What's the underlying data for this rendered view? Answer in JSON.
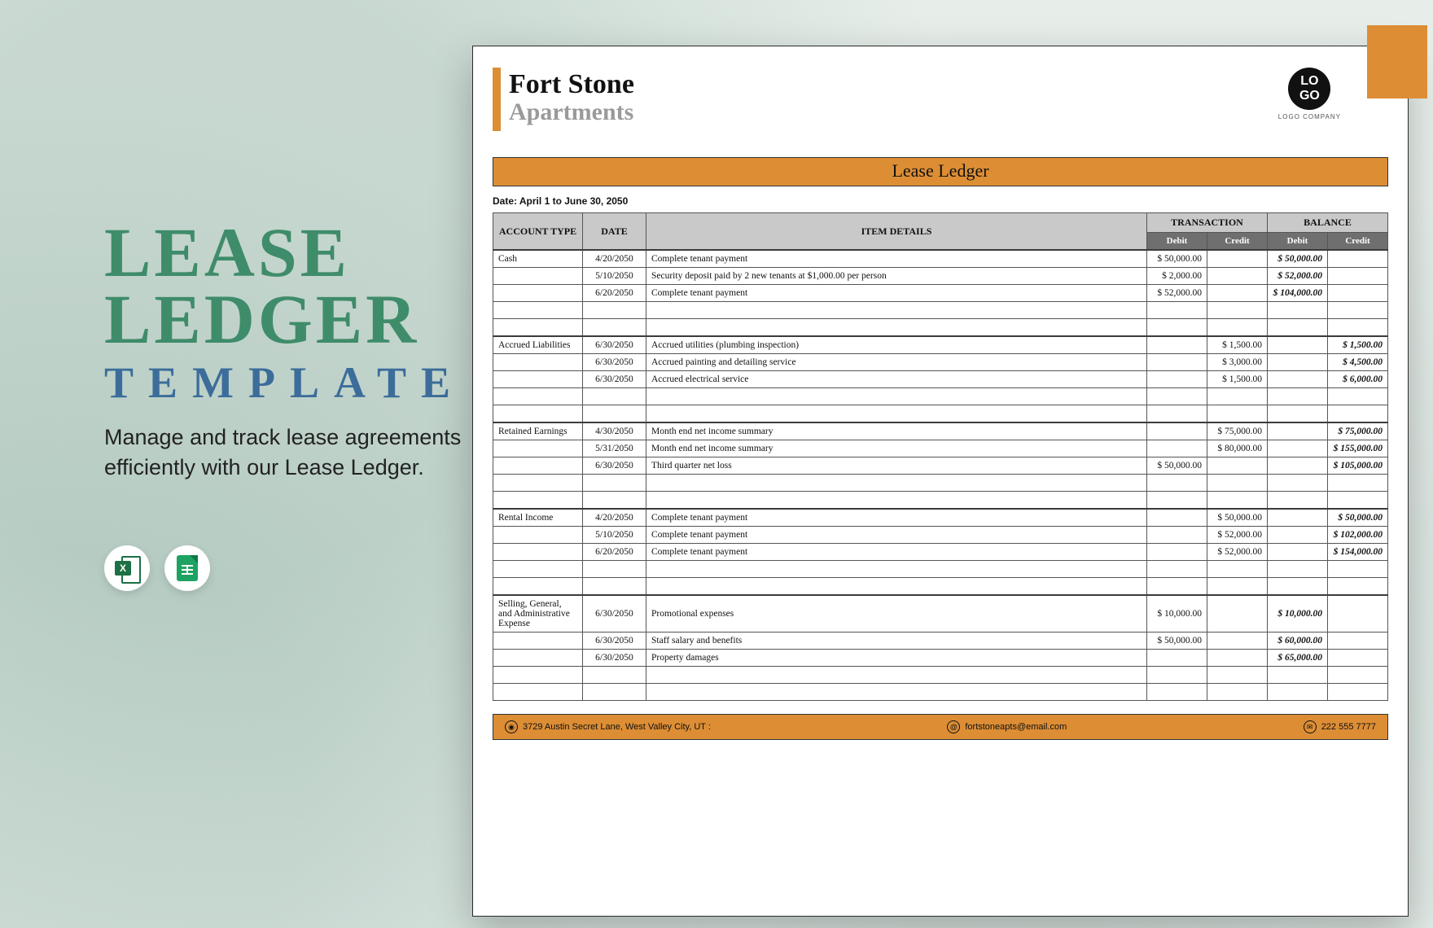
{
  "promo": {
    "line1": "LEASE",
    "line2": "LEDGER",
    "line3": "TEMPLATE",
    "tagline": "Manage and track lease agreements efficiently with our Lease Ledger."
  },
  "doc": {
    "company1": "Fort Stone",
    "company2": "Apartments",
    "logo1": "LO",
    "logo2": "GO",
    "logoLabel": "LOGO COMPANY",
    "banner": "Lease Ledger",
    "dateRange": "Date: April 1 to June 30, 2050",
    "headers": {
      "acct": "ACCOUNT TYPE",
      "date": "DATE",
      "item": "ITEM DETAILS",
      "trans": "TRANSACTION",
      "bal": "BALANCE",
      "debit": "Debit",
      "credit": "Credit"
    },
    "groups": [
      {
        "name": "Cash",
        "rows": [
          {
            "date": "4/20/2050",
            "item": "Complete tenant payment",
            "tD": "$    50,000.00",
            "tC": "",
            "bD": "$    50,000.00",
            "bC": ""
          },
          {
            "date": "5/10/2050",
            "item": "Security deposit paid by 2 new tenants at $1,000.00 per person",
            "tD": "$      2,000.00",
            "tC": "",
            "bD": "$    52,000.00",
            "bC": ""
          },
          {
            "date": "6/20/2050",
            "item": "Complete tenant payment",
            "tD": "$    52,000.00",
            "tC": "",
            "bD": "$  104,000.00",
            "bC": ""
          }
        ]
      },
      {
        "name": "Accrued Liabilities",
        "rows": [
          {
            "date": "6/30/2050",
            "item": "Accrued utilities (plumbing inspection)",
            "tD": "",
            "tC": "$      1,500.00",
            "bD": "",
            "bC": "$      1,500.00"
          },
          {
            "date": "6/30/2050",
            "item": "Accrued painting and detailing service",
            "tD": "",
            "tC": "$      3,000.00",
            "bD": "",
            "bC": "$      4,500.00"
          },
          {
            "date": "6/30/2050",
            "item": "Accrued electrical service",
            "tD": "",
            "tC": "$      1,500.00",
            "bD": "",
            "bC": "$      6,000.00"
          }
        ]
      },
      {
        "name": "Retained Earnings",
        "rows": [
          {
            "date": "4/30/2050",
            "item": "Month end net income summary",
            "tD": "",
            "tC": "$    75,000.00",
            "bD": "",
            "bC": "$    75,000.00"
          },
          {
            "date": "5/31/2050",
            "item": "Month end net income summary",
            "tD": "",
            "tC": "$    80,000.00",
            "bD": "",
            "bC": "$  155,000.00"
          },
          {
            "date": "6/30/2050",
            "item": "Third quarter net loss",
            "tD": "$    50,000.00",
            "tC": "",
            "bD": "",
            "bC": "$  105,000.00"
          }
        ]
      },
      {
        "name": "Rental Income",
        "rows": [
          {
            "date": "4/20/2050",
            "item": "Complete tenant payment",
            "tD": "",
            "tC": "$    50,000.00",
            "bD": "",
            "bC": "$    50,000.00"
          },
          {
            "date": "5/10/2050",
            "item": "Complete tenant payment",
            "tD": "",
            "tC": "$    52,000.00",
            "bD": "",
            "bC": "$  102,000.00"
          },
          {
            "date": "6/20/2050",
            "item": "Complete tenant payment",
            "tD": "",
            "tC": "$    52,000.00",
            "bD": "",
            "bC": "$  154,000.00"
          }
        ]
      },
      {
        "name": "Selling, General, and Administrative Expense",
        "rows": [
          {
            "date": "6/30/2050",
            "item": "Promotional expenses",
            "tD": "$    10,000.00",
            "tC": "",
            "bD": "$    10,000.00",
            "bC": ""
          },
          {
            "date": "6/30/2050",
            "item": "Staff salary and benefits",
            "tD": "$    50,000.00",
            "tC": "",
            "bD": "$    60,000.00",
            "bC": ""
          },
          {
            "date": "6/30/2050",
            "item": "Property damages",
            "tD": "",
            "tC": "",
            "bD": "$    65,000.00",
            "bC": ""
          }
        ]
      }
    ],
    "footer": {
      "address": "3729 Austin Secret Lane, West Valley City, UT :",
      "email": "fortstoneapts@email.com",
      "phone": "222 555 7777"
    }
  }
}
